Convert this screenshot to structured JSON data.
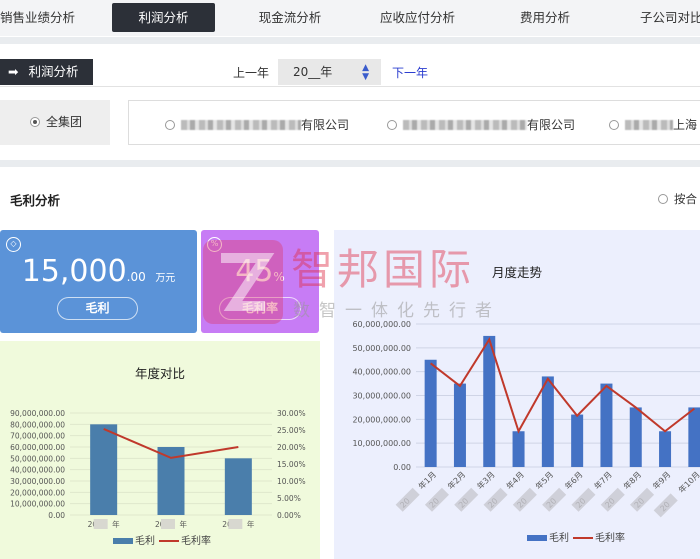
{
  "tabs": [
    {
      "label": "销售业绩分析",
      "active": false
    },
    {
      "label": "利润分析",
      "active": true
    },
    {
      "label": "现金流分析",
      "active": false
    },
    {
      "label": "应收应付分析",
      "active": false
    },
    {
      "label": "费用分析",
      "active": false
    },
    {
      "label": "子公司对比",
      "active": false
    }
  ],
  "section": {
    "label": "利润分析",
    "arrow_icon": "arrow-right-icon"
  },
  "year": {
    "prev": "上一年",
    "value": "20__年",
    "next": "下一年"
  },
  "group": {
    "label": "全集团",
    "selected": true
  },
  "companies": [
    {
      "suffix": "有限公司"
    },
    {
      "suffix": "有限公司"
    },
    {
      "suffix": "上海"
    }
  ],
  "analysis": {
    "title": "毛利分析",
    "by_company": "按合"
  },
  "cards": {
    "profit": {
      "value": "15,000",
      "decimals": ".00",
      "unit": "万元",
      "label": "毛利",
      "color": "#5b93d8"
    },
    "rate": {
      "value": "45",
      "unit": "%",
      "label": "毛利率",
      "color": "#c77cf5"
    }
  },
  "watermark": {
    "brand": "智邦国际",
    "slogan": "数智一体化先行者"
  },
  "colors": {
    "bar_year": "#4a7eab",
    "bar_month": "#4472c4",
    "line": "#c0392b"
  },
  "chart_data": [
    {
      "type": "bar",
      "title": "年度对比",
      "categories": [
        "20__年",
        "20__年",
        "20__年"
      ],
      "series": [
        {
          "name": "毛利",
          "type": "bar",
          "axis": "left",
          "values": [
            80000000,
            60000000,
            50000000
          ]
        },
        {
          "name": "毛利率",
          "type": "line",
          "axis": "right",
          "values": [
            25.3,
            16.8,
            20.0
          ]
        }
      ],
      "ylim": [
        0,
        90000000
      ],
      "y2lim": [
        0,
        30
      ],
      "yticks": [
        "0.00",
        "10,000,000.00",
        "20,000,000.00",
        "30,000,000.00",
        "40,000,000.00",
        "50,000,000.00",
        "60,000,000.00",
        "70,000,000.00",
        "80,000,000.00",
        "90,000,000.00"
      ],
      "y2ticks": [
        "0.00%",
        "5.00%",
        "10.00%",
        "15.00%",
        "20.00%",
        "25.00%",
        "30.00%"
      ],
      "legend": "bottom",
      "grid": true
    },
    {
      "type": "bar",
      "title": "月度走势",
      "categories": [
        "20__年1月",
        "20__年2月",
        "20__年3月",
        "20__年4月",
        "20__年5月",
        "20__年6月",
        "20__年7月",
        "20__年8月",
        "20__年9月",
        "20__年10月"
      ],
      "series": [
        {
          "name": "毛利",
          "type": "bar",
          "values": [
            45000000,
            35000000,
            55000000,
            15000000,
            38000000,
            22000000,
            35000000,
            25000000,
            15000000,
            25000000
          ]
        },
        {
          "name": "毛利率",
          "type": "line",
          "values": [
            43500000,
            34000000,
            53500000,
            15000000,
            37000000,
            21500000,
            34000000,
            25000000,
            15000000,
            24500000
          ]
        }
      ],
      "ylim": [
        0,
        60000000
      ],
      "yticks": [
        "0.00",
        "10,000,000.00",
        "20,000,000.00",
        "30,000,000.00",
        "40,000,000.00",
        "50,000,000.00",
        "60,000,000.00"
      ],
      "legend": "bottom",
      "grid": true
    }
  ]
}
